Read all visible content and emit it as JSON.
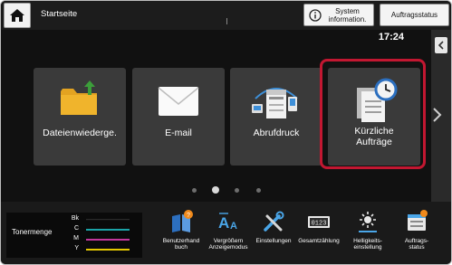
{
  "header": {
    "home_title": "Startseite",
    "system_info_line1": "System",
    "system_info_line2": "information.",
    "job_status": "Auftragsstatus"
  },
  "main": {
    "clock": "17:24",
    "tiles": [
      {
        "label": "Dateienwiederge."
      },
      {
        "label": "E-mail"
      },
      {
        "label": "Abrufdruck"
      },
      {
        "label_line1": "Kürzliche",
        "label_line2": "Aufträge"
      }
    ]
  },
  "bottom": {
    "toner_title": "Tonermenge",
    "toner_levels": [
      {
        "key": "Bk",
        "color": "#111111",
        "level": 1.0
      },
      {
        "key": "C",
        "color": "#1ba4a8",
        "level": 1.0
      },
      {
        "key": "M",
        "color": "#c2379b",
        "level": 1.0
      },
      {
        "key": "Y",
        "color": "#e5c800",
        "level": 1.0
      }
    ],
    "tools": [
      {
        "line1": "Benutzerhand",
        "line2": "buch",
        "icon": "book-icon"
      },
      {
        "line1": "Vergrößern",
        "line2": "Anzeigemodus",
        "icon": "font-size-icon"
      },
      {
        "line1": "Einstellungen",
        "line2": "",
        "icon": "tools-icon"
      },
      {
        "line1": "Gesamtzählung",
        "line2": "",
        "icon": "counter-icon"
      },
      {
        "line1": "Helligkeits-",
        "line2": "einstellung",
        "icon": "brightness-icon"
      },
      {
        "line1": "Auftrags-",
        "line2": "status",
        "icon": "job-status-icon"
      }
    ]
  },
  "colors": {
    "highlight": "#c21731",
    "tile_bg": "#3a3a3a",
    "toner_key": "#111111"
  }
}
